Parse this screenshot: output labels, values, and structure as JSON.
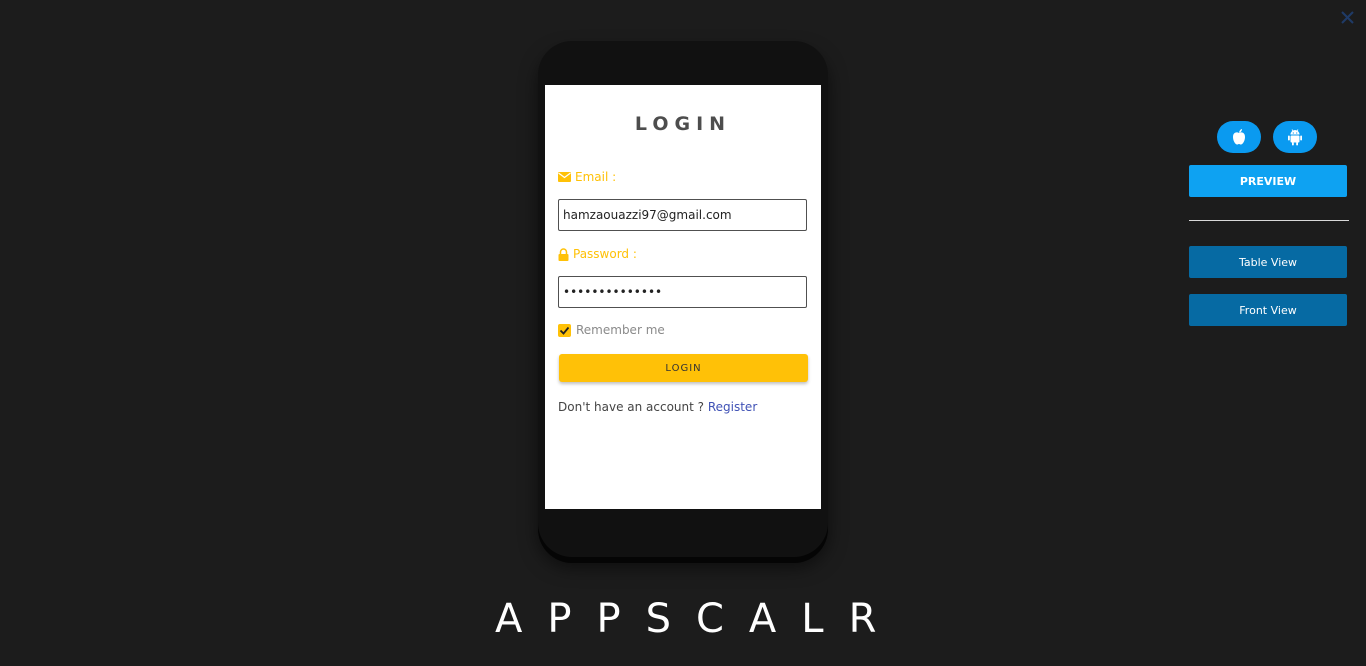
{
  "window": {
    "close_icon": "close-icon"
  },
  "login_screen": {
    "title": "LOGIN",
    "email_label": "Email :",
    "email_value": "hamzaouazzi97@gmail.com",
    "password_label": "Password :",
    "password_value": "passwordpasswo",
    "remember_label": "Remember me",
    "remember_checked": true,
    "login_button": "LOGIN",
    "register_prompt": "Don't have an account ? ",
    "register_link": "Register"
  },
  "brand": {
    "name": "APPSCALR"
  },
  "side_panel": {
    "platforms": [
      "apple-icon",
      "android-icon"
    ],
    "preview_button": "PREVIEW",
    "table_view_button": "Table View",
    "front_view_button": "Front View"
  },
  "colors": {
    "background": "#1c1c1c",
    "accent_yellow": "#ffc107",
    "preview_blue": "#0ea2f2",
    "view_blue": "#066aa3",
    "link_blue": "#3f51b5"
  }
}
